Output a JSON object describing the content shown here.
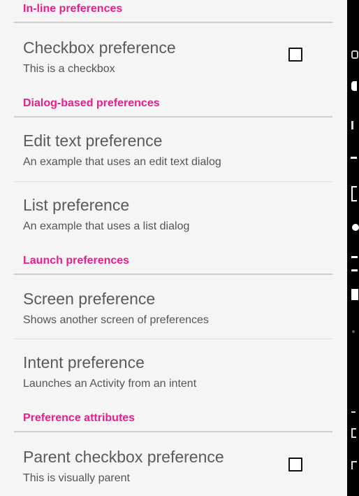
{
  "categories": [
    {
      "label": "In-line preferences"
    },
    {
      "label": "Dialog-based preferences"
    },
    {
      "label": "Launch preferences"
    },
    {
      "label": "Preference attributes"
    }
  ],
  "items": [
    {
      "title": "Checkbox preference",
      "summary": "This is a checkbox",
      "checked": false
    },
    {
      "title": "Edit text preference",
      "summary": "An example that uses an edit text dialog"
    },
    {
      "title": "List preference",
      "summary": "An example that uses a list dialog"
    },
    {
      "title": "Screen preference",
      "summary": "Shows another screen of preferences"
    },
    {
      "title": "Intent preference",
      "summary": "Launches an Activity from an intent"
    },
    {
      "title": "Parent checkbox preference",
      "summary": "This is visually parent",
      "checked": false
    }
  ],
  "colors": {
    "accent": "#e91e8c",
    "background": "#f5f5f5",
    "edge": "#000000"
  }
}
